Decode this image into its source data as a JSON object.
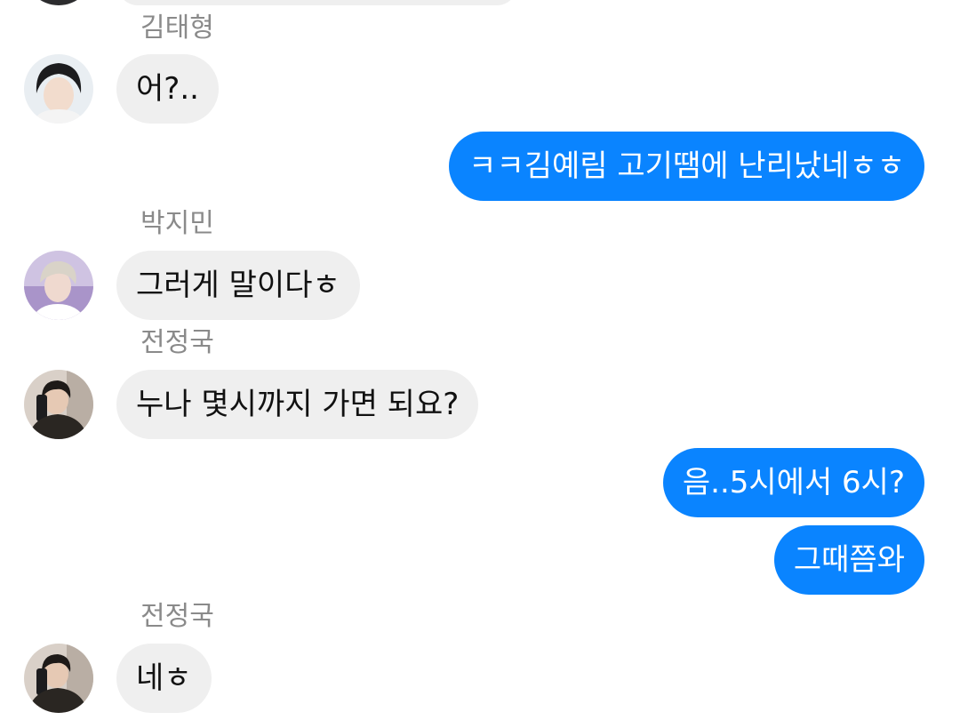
{
  "colors": {
    "incoming_bubble": "#efefef",
    "outgoing_bubble": "#0a84ff",
    "sender_name": "#8a8a8a"
  },
  "messages": [
    {
      "sender": "김태형",
      "avatar_icon": "user-avatar-icon",
      "text": "어?.."
    },
    {
      "direction": "outgoing",
      "text": "ㅋㅋ김예림 고기땜에 난리났네ㅎㅎ"
    },
    {
      "sender": "박지민",
      "avatar_icon": "user-avatar-icon",
      "text": "그러게 말이다ㅎ"
    },
    {
      "sender": "전정국",
      "avatar_icon": "user-avatar-icon",
      "text": "누나 몇시까지 가면 되요?"
    },
    {
      "direction": "outgoing",
      "text": "음..5시에서 6시?"
    },
    {
      "direction": "outgoing",
      "text": "그때쯤와"
    },
    {
      "sender": "전정국",
      "avatar_icon": "user-avatar-icon",
      "text": "네ㅎ"
    }
  ]
}
